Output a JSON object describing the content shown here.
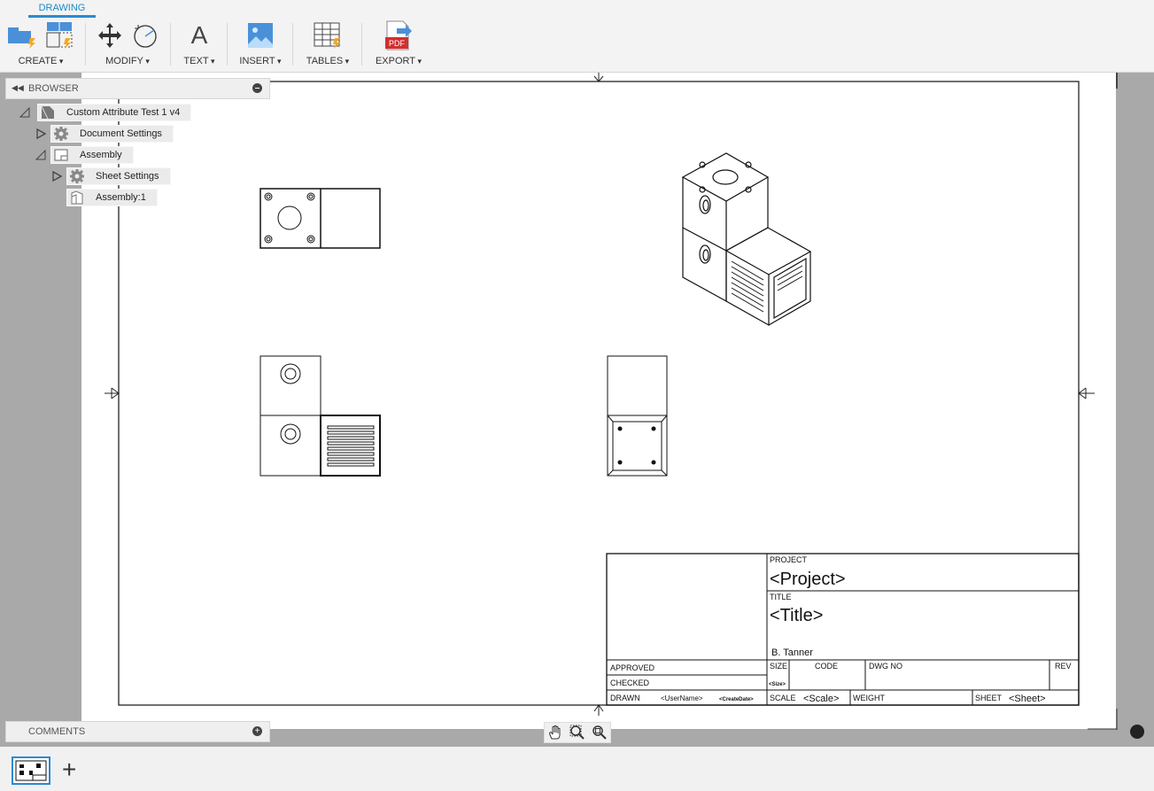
{
  "workspace_tab": "DRAWING",
  "toolbar": {
    "create": "CREATE",
    "modify": "MODIFY",
    "text": "TEXT",
    "text_glyph": "A",
    "insert": "INSERT",
    "tables": "TABLES",
    "export": "EXPORT",
    "pdf_badge": "PDF"
  },
  "browser": {
    "title": "BROWSER",
    "items": [
      {
        "label": "Custom Attribute Test 1 v4",
        "expanded": true,
        "icon": "document-icon"
      },
      {
        "label": "Document Settings",
        "expanded": false,
        "icon": "gear-icon"
      },
      {
        "label": "Assembly",
        "expanded": true,
        "icon": "sheet-icon"
      },
      {
        "label": "Sheet Settings",
        "expanded": false,
        "icon": "gear-icon"
      },
      {
        "label": "Assembly:1",
        "expanded": false,
        "icon": "view-icon"
      }
    ]
  },
  "comments": {
    "title": "COMMENTS"
  },
  "title_block": {
    "project_label": "PROJECT",
    "project_value": "<Project>",
    "title_label": "TITLE",
    "title_value": "<Title>",
    "author": "B. Tanner",
    "approved": "APPROVED",
    "checked": "CHECKED",
    "drawn": "DRAWN",
    "drawn_user": "<UserName>",
    "drawn_date": "<CreateDate>",
    "size_label": "SIZE",
    "size_value": "<Size>",
    "code_label": "CODE",
    "dwg_label": "DWG NO",
    "rev_label": "REV",
    "scale_label": "SCALE",
    "scale_value": "<Scale>",
    "weight_label": "WEIGHT",
    "sheet_label": "SHEET",
    "sheet_value": "<Sheet>"
  },
  "colors": {
    "accent": "#2a8ad0",
    "canvas": "#a9a9a9",
    "toolbar": "#f3f3f3"
  }
}
